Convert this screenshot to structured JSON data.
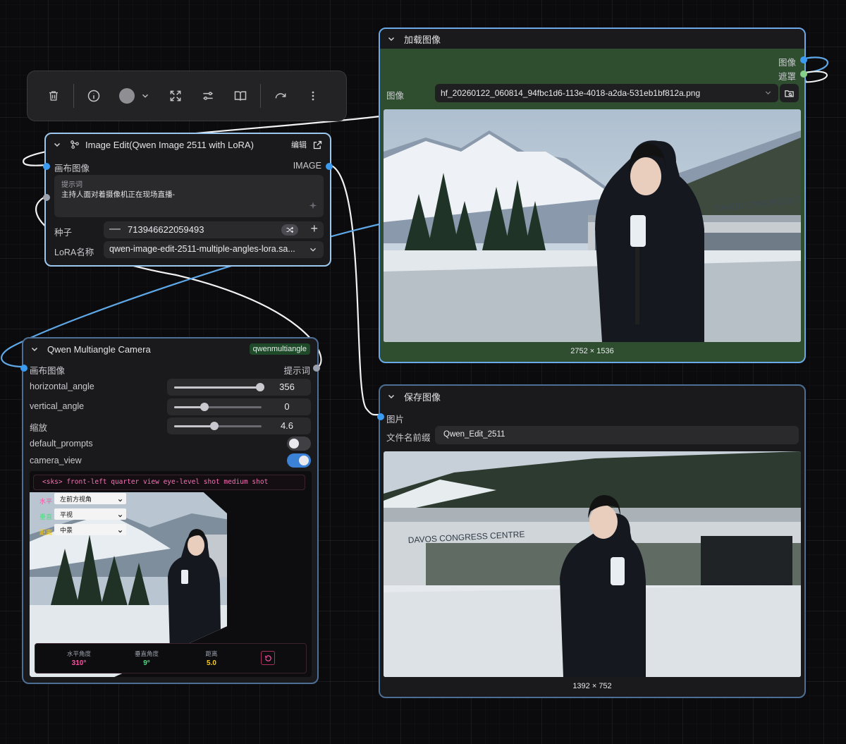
{
  "toolbar": {
    "icons": [
      "trash-icon",
      "info-icon",
      "color-circle",
      "chevron-down-icon",
      "fit-view-icon",
      "sliders-icon",
      "book-icon",
      "redo-icon",
      "more-vertical-icon"
    ]
  },
  "image_edit_node": {
    "title": "Image Edit(Qwen Image 2511 with LoRA)",
    "edit_label": "编辑",
    "input_canvas": "画布图像",
    "output_image": "IMAGE",
    "prompt_label": "提示词",
    "prompt_text": "主持人面对着摄像机正在现场直播-",
    "seed_label": "种子",
    "seed_value": "713946622059493",
    "lora_label": "LoRA名称",
    "lora_value": "qwen-image-edit-2511-multiple-angles-lora.sa..."
  },
  "load_image_node": {
    "title": "加载图像",
    "out_image": "图像",
    "out_mask": "遮罩",
    "image_label": "图像",
    "file_name": "hf_20260122_060814_94fbc1d6-113e-4018-a2da-531eb1bf812a.png",
    "dimensions": "2752 × 1536",
    "header_color": "#2f4e30"
  },
  "camera_node": {
    "title": "Qwen Multiangle Camera",
    "badge": "qwenmultiangle",
    "input_canvas": "画布图像",
    "output_prompt": "提示词",
    "horizontal_label": "horizontal_angle",
    "horizontal_value": "356",
    "horizontal_fraction": 0.98,
    "vertical_label": "vertical_angle",
    "vertical_value": "0",
    "vertical_fraction": 0.35,
    "zoom_label": "缩放",
    "zoom_value": "4.6",
    "zoom_fraction": 0.46,
    "default_prompts_label": "default_prompts",
    "default_prompts_on": false,
    "camera_view_label": "camera_view",
    "camera_view_on": true,
    "prompt_preview": "<sks> front-left quarter view eye-level shot medium shot",
    "h_label": "水平",
    "h_select": "左前方视角",
    "v_label": "垂直",
    "v_select": "平视",
    "d_label": "距离",
    "d_select": "中景",
    "stat_h_label": "水平角度",
    "stat_h_value": "310°",
    "stat_v_label": "垂直角度",
    "stat_v_value": "9°",
    "stat_d_label": "距离",
    "stat_d_value": "5.0",
    "colors": {
      "h": "#ff4fa3",
      "v": "#4ade80",
      "d": "#facc15"
    }
  },
  "save_image_node": {
    "title": "保存图像",
    "input_image": "图片",
    "prefix_label": "文件名前缀",
    "prefix_value": "Qwen_Edit_2511",
    "dimensions": "1392 × 752"
  },
  "photo_text": {
    "congress_sign": "DAVOS CONGRESS CENTRE"
  }
}
